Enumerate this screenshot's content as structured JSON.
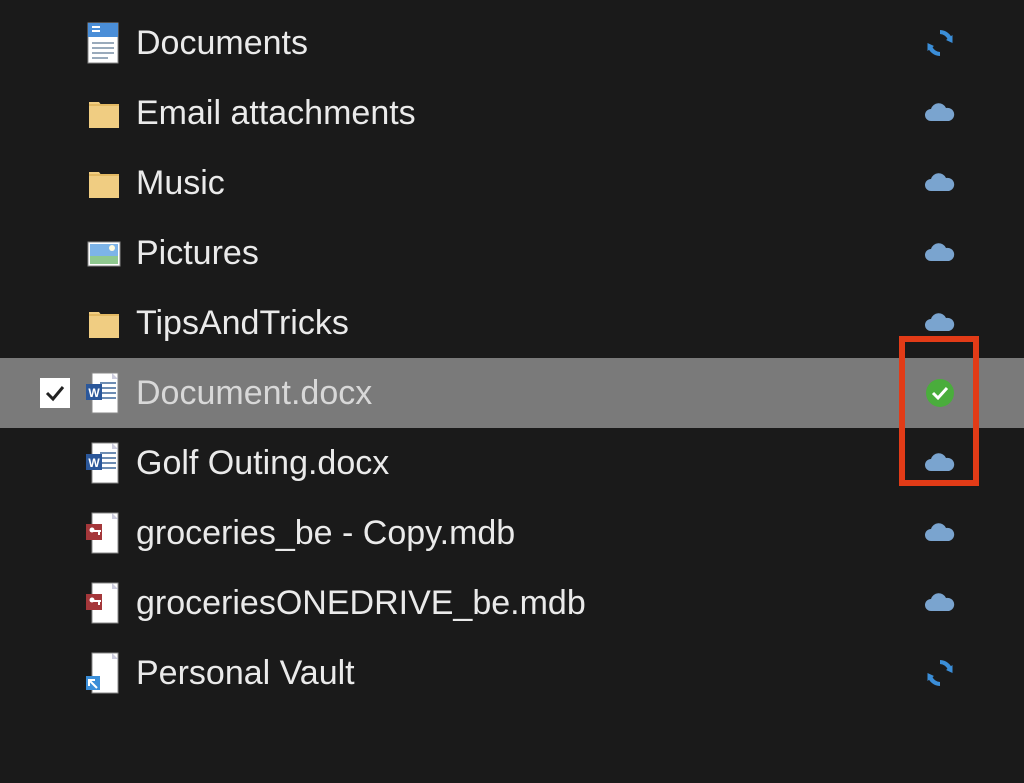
{
  "items": [
    {
      "name": "Documents",
      "icon": "document-library",
      "status": "sync",
      "selected": false
    },
    {
      "name": "Email attachments",
      "icon": "folder",
      "status": "cloud",
      "selected": false
    },
    {
      "name": "Music",
      "icon": "folder",
      "status": "cloud",
      "selected": false
    },
    {
      "name": "Pictures",
      "icon": "pictures-library",
      "status": "cloud",
      "selected": false
    },
    {
      "name": "TipsAndTricks",
      "icon": "folder",
      "status": "cloud",
      "selected": false
    },
    {
      "name": "Document.docx",
      "icon": "word-file",
      "status": "synced",
      "selected": true
    },
    {
      "name": "Golf Outing.docx",
      "icon": "word-file",
      "status": "cloud",
      "selected": false
    },
    {
      "name": "groceries_be - Copy.mdb",
      "icon": "access-file",
      "status": "cloud",
      "selected": false
    },
    {
      "name": "groceriesONEDRIVE_be.mdb",
      "icon": "access-file",
      "status": "cloud",
      "selected": false
    },
    {
      "name": "Personal Vault",
      "icon": "vault-shortcut",
      "status": "sync",
      "selected": false
    }
  ],
  "colors": {
    "highlight": "#e23b17",
    "cloud": "#7aa4cf",
    "sync": "#3b8ed8",
    "synced": "#4aa d3c"
  }
}
